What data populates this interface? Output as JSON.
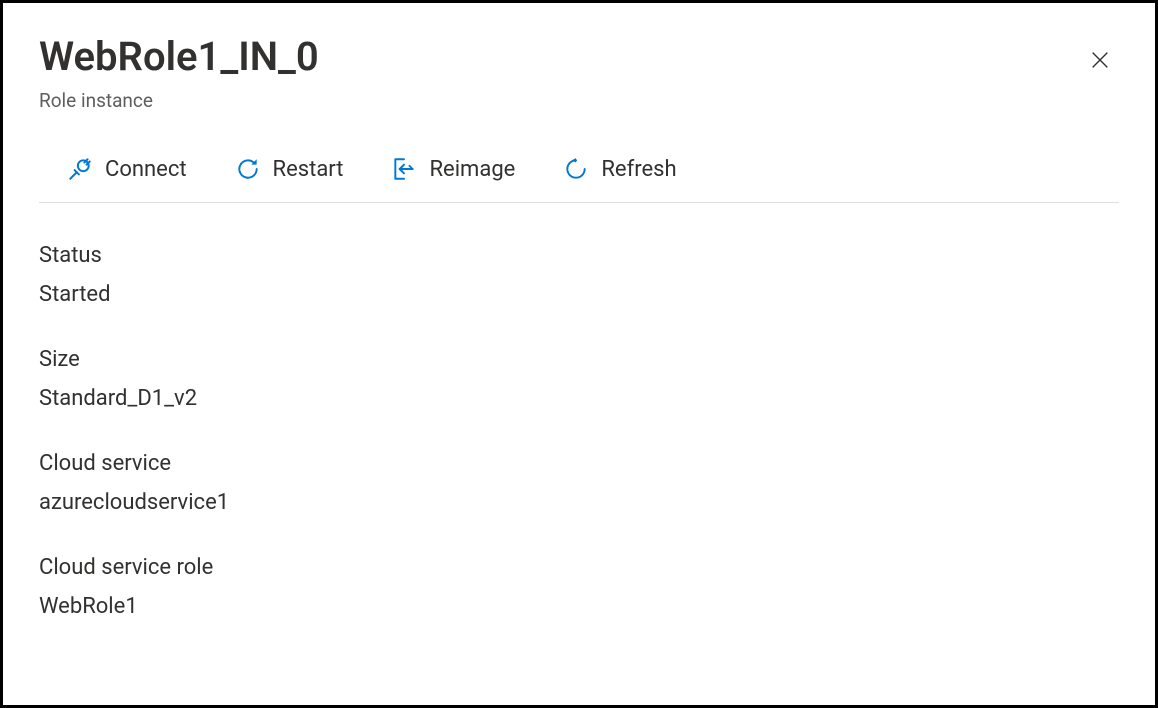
{
  "header": {
    "title": "WebRole1_IN_0",
    "subtitle": "Role instance"
  },
  "toolbar": {
    "connect_label": "Connect",
    "restart_label": "Restart",
    "reimage_label": "Reimage",
    "refresh_label": "Refresh"
  },
  "details": {
    "status_label": "Status",
    "status_value": "Started",
    "size_label": "Size",
    "size_value": "Standard_D1_v2",
    "cloud_service_label": "Cloud service",
    "cloud_service_value": "azurecloudservice1",
    "cloud_service_role_label": "Cloud service role",
    "cloud_service_role_value": "WebRole1"
  }
}
